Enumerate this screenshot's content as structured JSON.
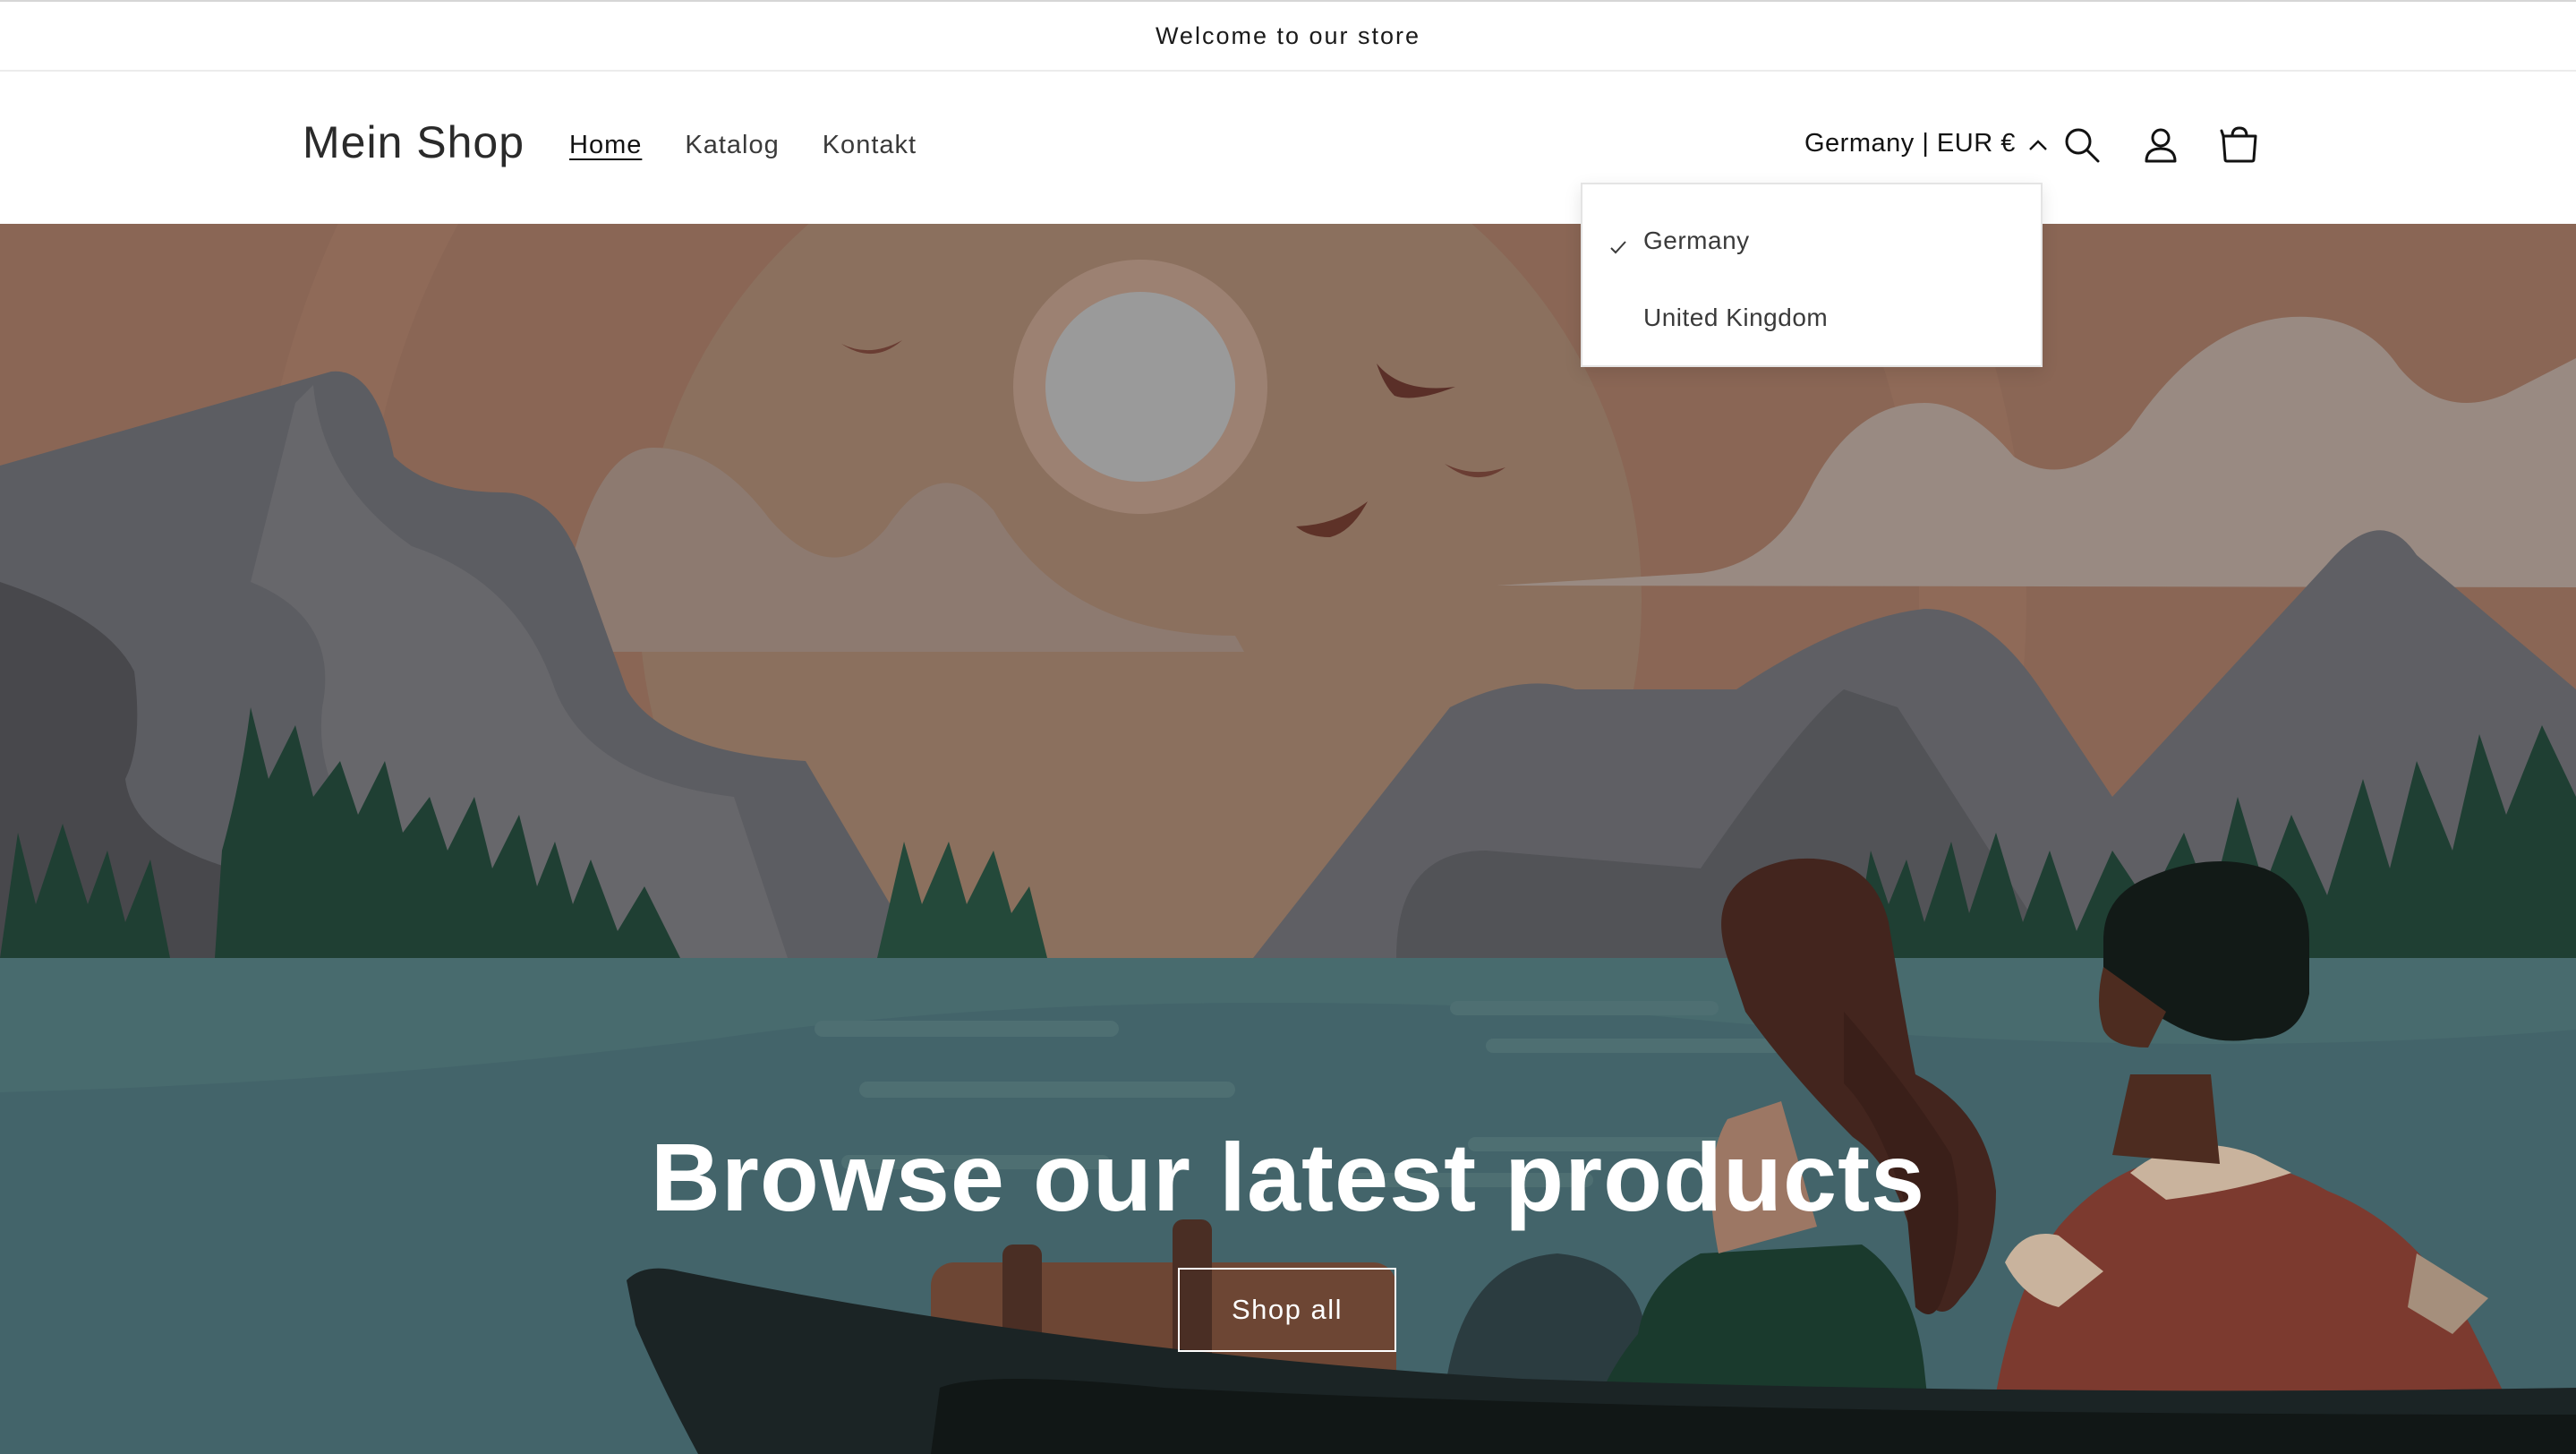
{
  "announcement": {
    "text": "Welcome to our store"
  },
  "header": {
    "logo": "Mein Shop",
    "nav": [
      {
        "label": "Home",
        "active": true
      },
      {
        "label": "Katalog",
        "active": false
      },
      {
        "label": "Kontakt",
        "active": false
      }
    ],
    "localization": {
      "label": "Germany | EUR €",
      "icon": "chevron-up-icon"
    },
    "icons": [
      "search-icon",
      "account-icon",
      "cart-icon"
    ]
  },
  "country_dropdown": {
    "options": [
      {
        "label": "Germany",
        "selected": true
      },
      {
        "label": "United Kingdom",
        "selected": false
      }
    ]
  },
  "hero": {
    "title": "Browse our latest products",
    "button_label": "Shop all"
  },
  "colors": {
    "sky": "#8c6a5a",
    "water": "#43646a",
    "trees": "#1f3f33",
    "mountain": "#5c5e63"
  }
}
